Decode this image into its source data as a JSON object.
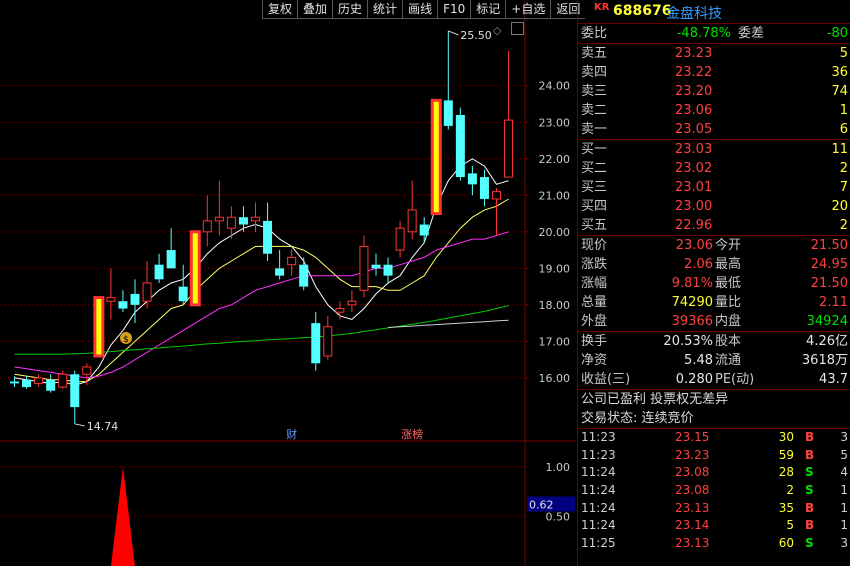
{
  "toolbar": {
    "buttons": [
      "复权",
      "叠加",
      "历史",
      "统计",
      "画线",
      "F10",
      "标记",
      "+自选",
      "返回"
    ],
    "close": "□"
  },
  "stock": {
    "tag": "KR",
    "code": "688676",
    "name": "金盘科技"
  },
  "ratio": {
    "wb_label": "委比",
    "wb_value": "-48.78%",
    "wc_label": "委差",
    "wc_value": "-80"
  },
  "sells": [
    {
      "label": "卖五",
      "price": "23.23",
      "vol": "5"
    },
    {
      "label": "卖四",
      "price": "23.22",
      "vol": "36"
    },
    {
      "label": "卖三",
      "price": "23.20",
      "vol": "74"
    },
    {
      "label": "卖二",
      "price": "23.06",
      "vol": "1"
    },
    {
      "label": "卖一",
      "price": "23.05",
      "vol": "6"
    }
  ],
  "buys": [
    {
      "label": "买一",
      "price": "23.03",
      "vol": "11"
    },
    {
      "label": "买二",
      "price": "23.02",
      "vol": "2"
    },
    {
      "label": "买三",
      "price": "23.01",
      "vol": "7"
    },
    {
      "label": "买四",
      "price": "23.00",
      "vol": "20"
    },
    {
      "label": "买五",
      "price": "22.96",
      "vol": "2"
    }
  ],
  "quote": [
    {
      "l1": "现价",
      "v1": "23.06",
      "c1": "red",
      "l2": "今开",
      "v2": "21.50",
      "c2": "red"
    },
    {
      "l1": "涨跌",
      "v1": "2.06",
      "c1": "red",
      "l2": "最高",
      "v2": "24.95",
      "c2": "red"
    },
    {
      "l1": "涨幅",
      "v1": "9.81%",
      "c1": "red",
      "l2": "最低",
      "v2": "21.50",
      "c2": "red"
    },
    {
      "l1": "总量",
      "v1": "74290",
      "c1": "yellow",
      "l2": "量比",
      "v2": "2.11",
      "c2": "red"
    },
    {
      "l1": "外盘",
      "v1": "39366",
      "c1": "red",
      "l2": "内盘",
      "v2": "34924",
      "c2": "green"
    }
  ],
  "stats": [
    {
      "l1": "换手",
      "v1": "20.53%",
      "l2": "股本",
      "v2": "4.26亿"
    },
    {
      "l1": "净资",
      "v1": "5.48",
      "l2": "流通",
      "v2": "3618万"
    },
    {
      "l1": "收益(三)",
      "v1": "0.280",
      "l2": "PE(动)",
      "v2": "43.7"
    }
  ],
  "notes": [
    "公司已盈利 投票权无差异",
    "交易状态: 连续竞价"
  ],
  "trades": [
    {
      "time": "11:23",
      "price": "23.15",
      "qty": "30",
      "side": "B",
      "num": "3"
    },
    {
      "time": "11:23",
      "price": "23.23",
      "qty": "59",
      "side": "B",
      "num": "5"
    },
    {
      "time": "11:24",
      "price": "23.08",
      "qty": "28",
      "side": "S",
      "num": "4"
    },
    {
      "time": "11:24",
      "price": "23.08",
      "qty": "2",
      "side": "S",
      "num": "1"
    },
    {
      "time": "11:24",
      "price": "23.13",
      "qty": "35",
      "side": "B",
      "num": "1"
    },
    {
      "time": "11:24",
      "price": "23.14",
      "qty": "5",
      "side": "B",
      "num": "1"
    },
    {
      "time": "11:25",
      "price": "23.13",
      "qty": "60",
      "side": "S",
      "num": "3"
    }
  ],
  "colors": {
    "up": "#ff3333",
    "down": "#54ffff",
    "limit_up_fill": "#ffff00",
    "ma5": "#ffffff",
    "ma10": "#ffff66",
    "ma20": "#ff33ff",
    "ma60": "#00cc00",
    "ma120": "#cccccc",
    "grid": "#7a0000",
    "axis_label": "#c8c8c8"
  },
  "chart_data": {
    "type": "candlestick",
    "y_ticks": [
      "16.00",
      "17.00",
      "18.00",
      "19.00",
      "20.00",
      "21.00",
      "22.00",
      "23.00",
      "24.00"
    ],
    "ylim": [
      14.3,
      25.8
    ],
    "high_annotation": "25.50",
    "low_annotation": "14.74",
    "markers": [
      {
        "label": "财",
        "index": 23
      },
      {
        "label": "涨榜",
        "index": 33
      }
    ],
    "candles": [
      {
        "o": 15.9,
        "h": 16.05,
        "l": 15.75,
        "c": 15.85,
        "dir": "down"
      },
      {
        "o": 15.95,
        "h": 16.05,
        "l": 15.7,
        "c": 15.75,
        "dir": "down"
      },
      {
        "o": 15.85,
        "h": 16.1,
        "l": 15.75,
        "c": 16.0,
        "dir": "up"
      },
      {
        "o": 15.95,
        "h": 16.1,
        "l": 15.6,
        "c": 15.65,
        "dir": "down"
      },
      {
        "o": 15.75,
        "h": 16.2,
        "l": 15.7,
        "c": 16.1,
        "dir": "up"
      },
      {
        "o": 16.1,
        "h": 16.2,
        "l": 14.74,
        "c": 15.2,
        "dir": "down"
      },
      {
        "o": 16.1,
        "h": 16.4,
        "l": 15.8,
        "c": 16.3,
        "dir": "up"
      },
      {
        "o": 16.6,
        "h": 18.2,
        "l": 16.6,
        "c": 18.2,
        "dir": "up",
        "limit": true
      },
      {
        "o": 18.1,
        "h": 19.0,
        "l": 17.6,
        "c": 18.2,
        "dir": "up"
      },
      {
        "o": 18.1,
        "h": 18.4,
        "l": 17.8,
        "c": 17.9,
        "dir": "down"
      },
      {
        "o": 18.0,
        "h": 18.7,
        "l": 17.5,
        "c": 18.3,
        "dir": "down"
      },
      {
        "o": 18.1,
        "h": 19.2,
        "l": 17.9,
        "c": 18.6,
        "dir": "up"
      },
      {
        "o": 18.7,
        "h": 19.4,
        "l": 18.6,
        "c": 19.1,
        "dir": "down"
      },
      {
        "o": 19.5,
        "h": 20.1,
        "l": 19.0,
        "c": 19.0,
        "dir": "down"
      },
      {
        "o": 18.5,
        "h": 19.1,
        "l": 18.0,
        "c": 18.1,
        "dir": "down"
      },
      {
        "o": 18.0,
        "h": 20.0,
        "l": 18.0,
        "c": 20.0,
        "dir": "up",
        "limit": true
      },
      {
        "o": 20.0,
        "h": 21.0,
        "l": 19.6,
        "c": 20.3,
        "dir": "up"
      },
      {
        "o": 20.3,
        "h": 21.4,
        "l": 19.9,
        "c": 20.4,
        "dir": "up"
      },
      {
        "o": 20.4,
        "h": 20.7,
        "l": 19.8,
        "c": 20.1,
        "dir": "up"
      },
      {
        "o": 20.4,
        "h": 20.7,
        "l": 20.0,
        "c": 20.2,
        "dir": "down"
      },
      {
        "o": 20.4,
        "h": 20.8,
        "l": 20.0,
        "c": 20.3,
        "dir": "up"
      },
      {
        "o": 20.3,
        "h": 20.8,
        "l": 19.2,
        "c": 19.4,
        "dir": "down"
      },
      {
        "o": 19.0,
        "h": 19.5,
        "l": 18.7,
        "c": 18.8,
        "dir": "down"
      },
      {
        "o": 19.1,
        "h": 19.5,
        "l": 18.8,
        "c": 19.3,
        "dir": "up"
      },
      {
        "o": 19.1,
        "h": 19.3,
        "l": 18.4,
        "c": 18.5,
        "dir": "down"
      },
      {
        "o": 17.5,
        "h": 17.8,
        "l": 16.2,
        "c": 16.4,
        "dir": "down"
      },
      {
        "o": 16.6,
        "h": 17.7,
        "l": 16.5,
        "c": 17.4,
        "dir": "up"
      },
      {
        "o": 17.8,
        "h": 18.1,
        "l": 17.6,
        "c": 17.9,
        "dir": "up"
      },
      {
        "o": 18.0,
        "h": 18.4,
        "l": 17.8,
        "c": 18.1,
        "dir": "up"
      },
      {
        "o": 18.4,
        "h": 19.9,
        "l": 18.2,
        "c": 19.6,
        "dir": "up"
      },
      {
        "o": 19.1,
        "h": 19.4,
        "l": 18.8,
        "c": 19.0,
        "dir": "down"
      },
      {
        "o": 19.1,
        "h": 19.3,
        "l": 18.6,
        "c": 18.8,
        "dir": "down"
      },
      {
        "o": 19.5,
        "h": 20.3,
        "l": 19.3,
        "c": 20.1,
        "dir": "up"
      },
      {
        "o": 20.0,
        "h": 21.4,
        "l": 19.8,
        "c": 20.6,
        "dir": "up"
      },
      {
        "o": 19.9,
        "h": 20.4,
        "l": 19.7,
        "c": 20.2,
        "dir": "down"
      },
      {
        "o": 20.5,
        "h": 23.6,
        "l": 20.5,
        "c": 23.6,
        "dir": "up",
        "limit": true
      },
      {
        "o": 23.6,
        "h": 25.5,
        "l": 22.8,
        "c": 22.9,
        "dir": "down"
      },
      {
        "o": 23.2,
        "h": 23.4,
        "l": 21.4,
        "c": 21.5,
        "dir": "down"
      },
      {
        "o": 21.6,
        "h": 21.8,
        "l": 21.0,
        "c": 21.3,
        "dir": "down"
      },
      {
        "o": 21.5,
        "h": 21.7,
        "l": 20.7,
        "c": 20.9,
        "dir": "down"
      },
      {
        "o": 20.9,
        "h": 21.2,
        "l": 19.9,
        "c": 21.1,
        "dir": "up"
      },
      {
        "o": 21.5,
        "h": 24.95,
        "l": 21.5,
        "c": 23.06,
        "dir": "up"
      }
    ],
    "ma_series": [
      {
        "key": "ma5",
        "values": [
          16.0,
          15.95,
          15.9,
          15.85,
          15.9,
          15.8,
          15.9,
          16.3,
          16.9,
          17.3,
          17.8,
          18.1,
          18.4,
          18.6,
          18.7,
          19.0,
          19.4,
          19.7,
          19.9,
          20.1,
          20.2,
          20.1,
          19.8,
          19.6,
          19.2,
          18.5,
          18.0,
          17.7,
          17.6,
          17.9,
          18.3,
          18.6,
          18.8,
          19.3,
          19.7,
          20.7,
          21.4,
          21.8,
          22.0,
          21.8,
          21.3,
          21.4
        ]
      },
      {
        "key": "ma10",
        "values": [
          16.1,
          16.05,
          16.0,
          15.95,
          15.95,
          15.9,
          15.9,
          16.1,
          16.4,
          16.7,
          17.0,
          17.3,
          17.6,
          17.9,
          18.0,
          18.4,
          18.7,
          19.0,
          19.2,
          19.4,
          19.6,
          19.6,
          19.6,
          19.6,
          19.5,
          19.3,
          19.0,
          18.7,
          18.5,
          18.5,
          18.5,
          18.4,
          18.4,
          18.6,
          18.8,
          19.3,
          19.7,
          20.1,
          20.4,
          20.6,
          20.7,
          20.9
        ]
      },
      {
        "key": "ma20",
        "values": [
          16.3,
          16.25,
          16.2,
          16.15,
          16.1,
          16.05,
          16.0,
          16.05,
          16.15,
          16.3,
          16.5,
          16.7,
          16.9,
          17.1,
          17.3,
          17.5,
          17.7,
          17.9,
          18.0,
          18.2,
          18.4,
          18.5,
          18.6,
          18.7,
          18.8,
          18.8,
          18.8,
          18.8,
          18.8,
          18.9,
          19.0,
          19.0,
          19.1,
          19.2,
          19.3,
          19.5,
          19.6,
          19.7,
          19.8,
          19.8,
          19.9,
          20.0
        ]
      },
      {
        "key": "ma60",
        "values": [
          16.65,
          16.65,
          16.65,
          16.65,
          16.65,
          16.66,
          16.67,
          16.7,
          16.72,
          16.75,
          16.77,
          16.8,
          16.82,
          16.85,
          16.87,
          16.9,
          16.93,
          16.95,
          16.98,
          17.0,
          17.02,
          17.04,
          17.06,
          17.08,
          17.1,
          17.12,
          17.15,
          17.18,
          17.22,
          17.27,
          17.32,
          17.37,
          17.42,
          17.47,
          17.52,
          17.58,
          17.64,
          17.7,
          17.76,
          17.82,
          17.9,
          17.98
        ]
      },
      {
        "key": "ma120",
        "values": [
          null,
          null,
          null,
          null,
          null,
          null,
          null,
          null,
          null,
          null,
          null,
          null,
          null,
          null,
          null,
          null,
          null,
          null,
          null,
          null,
          null,
          null,
          null,
          null,
          null,
          null,
          null,
          null,
          null,
          null,
          null,
          17.38,
          17.4,
          17.42,
          17.44,
          17.46,
          17.48,
          17.5,
          17.52,
          17.54,
          17.56,
          17.58
        ]
      }
    ],
    "indicator": {
      "ticks": [
        "0.50",
        "1.00"
      ],
      "current_value": "0.62",
      "ylim": [
        0,
        1.25
      ],
      "spike_index": 9,
      "spike_value": 1.0
    }
  }
}
